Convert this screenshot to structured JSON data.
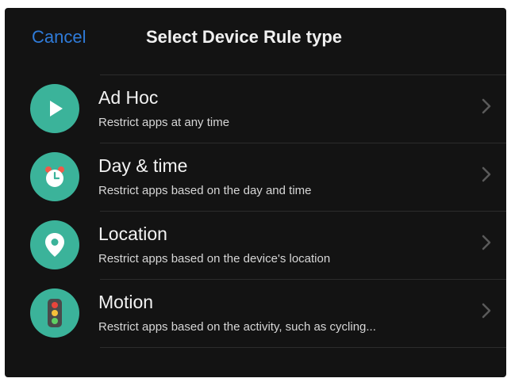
{
  "header": {
    "cancel_label": "Cancel",
    "title": "Select Device Rule type"
  },
  "rules": [
    {
      "label": "Ad Hoc",
      "description": "Restrict apps at any time",
      "icon": "play-icon"
    },
    {
      "label": "Day & time",
      "description": "Restrict apps based on the day and time",
      "icon": "alarm-clock-icon"
    },
    {
      "label": "Location",
      "description": "Restrict apps based on the device's location",
      "icon": "location-pin-icon"
    },
    {
      "label": "Motion",
      "description": "Restrict apps based on the activity, such as cycling...",
      "icon": "traffic-light-icon"
    }
  ],
  "colors": {
    "background": "#131313",
    "accent": "#2f7bd9",
    "icon_circle": "#3bb39a"
  }
}
